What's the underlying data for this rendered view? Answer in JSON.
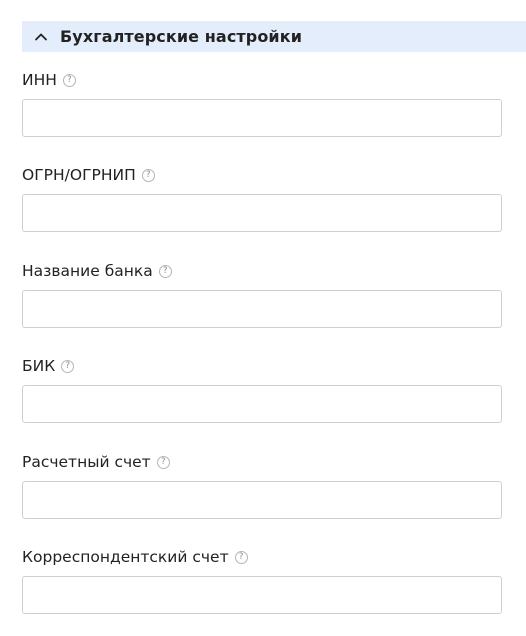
{
  "section": {
    "title": "Бухгалтерские настройки",
    "icon": "chevron-up-icon",
    "expanded": true
  },
  "help_icon_glyph": "?",
  "fields": [
    {
      "label": "ИНН",
      "value": "",
      "placeholder": ""
    },
    {
      "label": "ОГРН/ОГРНИП",
      "value": "",
      "placeholder": ""
    },
    {
      "label": "Название банка",
      "value": "",
      "placeholder": ""
    },
    {
      "label": "БИК",
      "value": "",
      "placeholder": ""
    },
    {
      "label": "Расчетный счет",
      "value": "",
      "placeholder": ""
    },
    {
      "label": "Корреспондентский счет",
      "value": "",
      "placeholder": ""
    }
  ],
  "colors": {
    "header_bg": "#e3edfb",
    "text": "#222222",
    "input_border": "#cfcfcf",
    "help_icon": "#b5b5b5"
  }
}
